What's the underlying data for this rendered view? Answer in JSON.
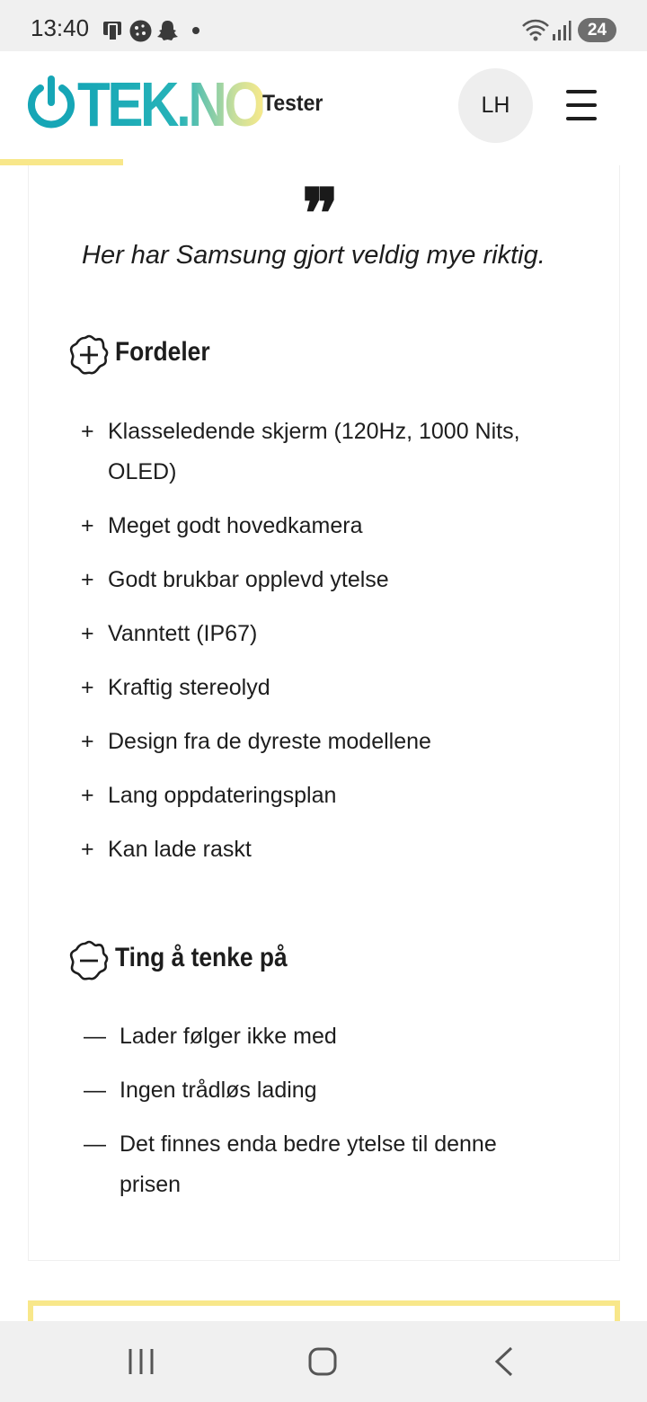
{
  "status_bar": {
    "time": "13:40",
    "battery": "24",
    "left_icons": [
      "screen-cast-icon",
      "cookie-icon",
      "snapchat-icon",
      "dot-icon"
    ],
    "right_icons": [
      "wifi-icon",
      "signal-icon",
      "battery-icon"
    ]
  },
  "header": {
    "logo_text": "TEK.NO",
    "section_label": "Tester",
    "avatar_initials": "LH",
    "accent_color": "#f8e78a",
    "brand_color": "#16a6b6"
  },
  "review": {
    "quote_mark": "❞",
    "quote": "Her har Samsung gjort veldig mye riktig.",
    "pros": {
      "heading": "Fordeler",
      "bullet": "+",
      "items": [
        "Klasseledende skjerm (120Hz, 1000 Nits,",
        "OLED)",
        "Meget godt hovedkamera",
        "Godt brukbar opplevd ytelse",
        "Vanntett (IP67)",
        "Kraftig stereolyd",
        "Design fra de dyreste modellene",
        "Lang oppdateringsplan",
        "Kan lade raskt"
      ]
    },
    "cons": {
      "heading": "Ting å tenke på",
      "bullet": "—",
      "items": [
        "Lader følger ikke med",
        "Ingen trådløs lading",
        "Det finnes enda bedre ytelse til denne",
        "prisen"
      ]
    }
  },
  "nav_bar": {
    "buttons": [
      "recent-apps-icon",
      "home-icon",
      "back-icon"
    ]
  }
}
